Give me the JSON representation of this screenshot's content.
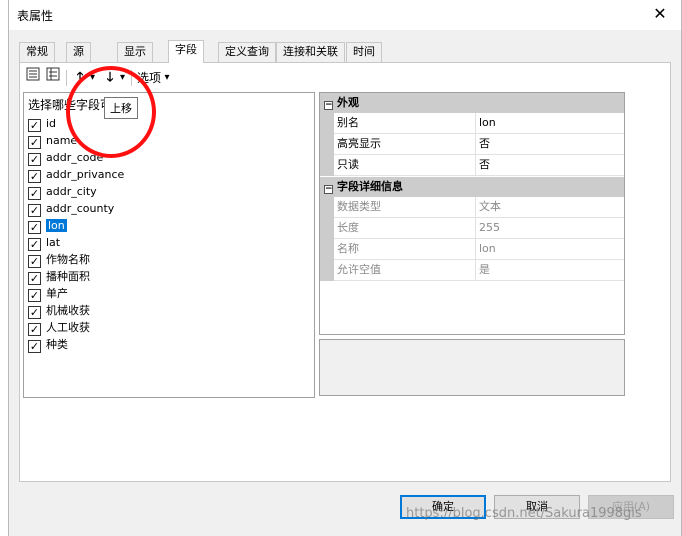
{
  "window": {
    "title": "表属性",
    "close_glyph": "✕"
  },
  "tabs": [
    {
      "label": "常规",
      "active": false
    },
    {
      "label": "源",
      "active": false
    },
    {
      "label": "显示",
      "active": false
    },
    {
      "label": "字段",
      "active": true
    },
    {
      "label": "定义查询",
      "active": false
    },
    {
      "label": "连接和关联",
      "active": false
    },
    {
      "label": "时间",
      "active": false
    }
  ],
  "toolbar": {
    "move_up_glyph": "🡑",
    "move_down_glyph": "🡓",
    "dropdown_glyph": "▾",
    "options_label": "选项",
    "tooltip": "上移"
  },
  "fields": {
    "header": "选择哪些字段可见",
    "items": [
      {
        "name": "id",
        "checked": true,
        "selected": false
      },
      {
        "name": "name",
        "checked": true,
        "selected": false
      },
      {
        "name": "addr_code",
        "checked": true,
        "selected": false
      },
      {
        "name": "addr_privance",
        "checked": true,
        "selected": false
      },
      {
        "name": "addr_city",
        "checked": true,
        "selected": false
      },
      {
        "name": "addr_county",
        "checked": true,
        "selected": false
      },
      {
        "name": "lon",
        "checked": true,
        "selected": true
      },
      {
        "name": "lat",
        "checked": true,
        "selected": false
      },
      {
        "name": "作物名称",
        "checked": true,
        "selected": false
      },
      {
        "name": "播种面积",
        "checked": true,
        "selected": false
      },
      {
        "name": "单产",
        "checked": true,
        "selected": false
      },
      {
        "name": "机械收获",
        "checked": true,
        "selected": false
      },
      {
        "name": "人工收获",
        "checked": true,
        "selected": false
      },
      {
        "name": "种类",
        "checked": true,
        "selected": false
      }
    ]
  },
  "properties": {
    "appearance": {
      "title": "外观",
      "rows": [
        {
          "name": "别名",
          "value": "lon"
        },
        {
          "name": "高亮显示",
          "value": "否"
        },
        {
          "name": "只读",
          "value": "否"
        }
      ]
    },
    "details": {
      "title": "字段详细信息",
      "rows": [
        {
          "name": "数据类型",
          "value": "文本"
        },
        {
          "name": "长度",
          "value": "255"
        },
        {
          "name": "名称",
          "value": "lon"
        },
        {
          "name": "允许空值",
          "value": "是"
        }
      ]
    }
  },
  "buttons": {
    "ok": "确定",
    "cancel": "取消",
    "apply": "应用(A)"
  },
  "watermark": "https://blog.csdn.net/Sakura1998gis",
  "colors": {
    "selection": "#0078d7",
    "annotation_ring": "#ff1010",
    "category_bg": "#cccccc"
  }
}
